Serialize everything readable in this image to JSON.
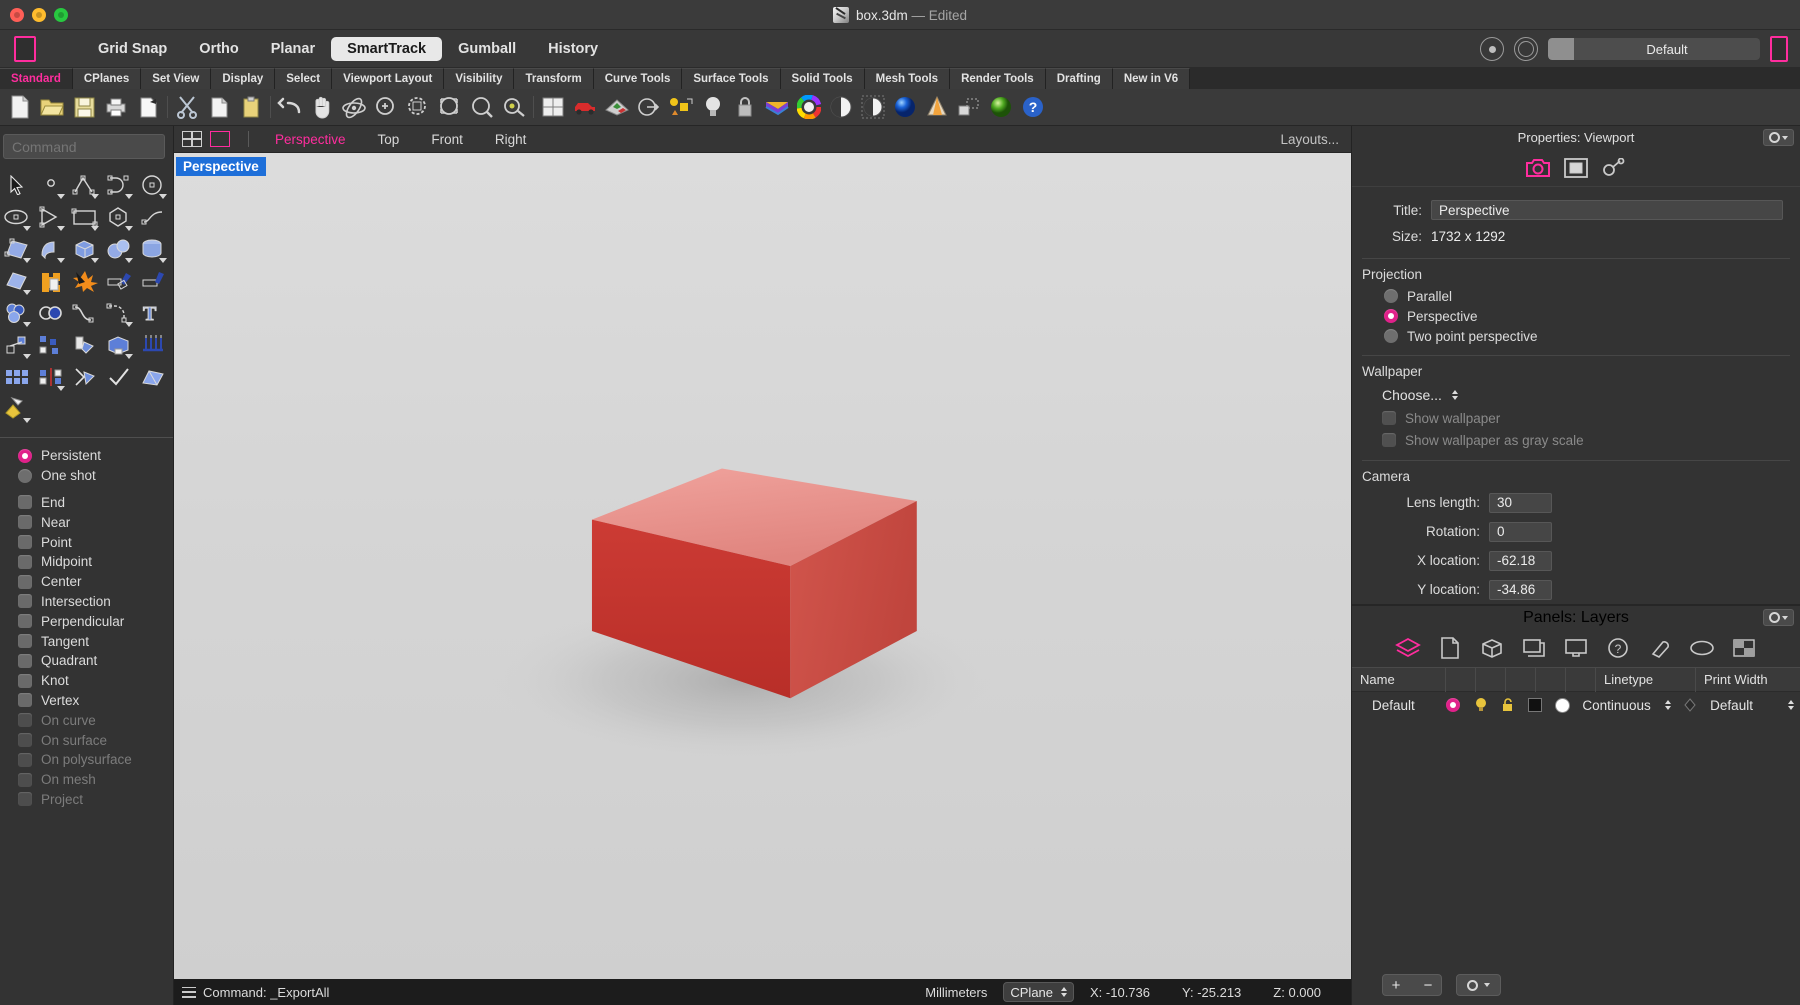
{
  "window": {
    "title": "box.3dm",
    "title_suffix": "— Edited",
    "traffic_lights": [
      "close",
      "minimize",
      "maximize"
    ]
  },
  "modebar": {
    "modes": [
      {
        "label": "Grid Snap",
        "active": false
      },
      {
        "label": "Ortho",
        "active": false
      },
      {
        "label": "Planar",
        "active": false
      },
      {
        "label": "SmartTrack",
        "active": true
      },
      {
        "label": "Gumball",
        "active": false
      },
      {
        "label": "History",
        "active": false
      }
    ],
    "display_mode": "Default"
  },
  "tabs": [
    {
      "label": "Standard",
      "active": true
    },
    {
      "label": "CPlanes",
      "active": false
    },
    {
      "label": "Set View",
      "active": false
    },
    {
      "label": "Display",
      "active": false
    },
    {
      "label": "Select",
      "active": false
    },
    {
      "label": "Viewport Layout",
      "active": false
    },
    {
      "label": "Visibility",
      "active": false
    },
    {
      "label": "Transform",
      "active": false
    },
    {
      "label": "Curve Tools",
      "active": false
    },
    {
      "label": "Surface Tools",
      "active": false
    },
    {
      "label": "Solid Tools",
      "active": false
    },
    {
      "label": "Mesh Tools",
      "active": false
    },
    {
      "label": "Render Tools",
      "active": false
    },
    {
      "label": "Drafting",
      "active": false
    },
    {
      "label": "New in V6",
      "active": false
    }
  ],
  "toolbar_icons": [
    "new-file-icon",
    "open-folder-icon",
    "save-icon",
    "print-icon",
    "copy-page-icon",
    "sep",
    "cut-scissors-icon",
    "copy-icon",
    "paste-clipboard-icon",
    "sep",
    "undo-icon",
    "pan-hand-icon",
    "rotate-view-icon",
    "zoom-window-icon",
    "zoom-extents-icon",
    "zoom-selected-icon",
    "zoom-dynamic-icon",
    "zoom-target-icon",
    "sep",
    "viewport-layout-icon",
    "car-render-icon",
    "render-preview-icon",
    "dimension-icon",
    "object-snap-icon",
    "light-bulb-icon",
    "lock-icon",
    "surface-icon",
    "color-wheel-icon",
    "shade-sphere-icon",
    "ghosted-sphere-icon",
    "rendered-sphere-icon",
    "cone-icon",
    "group-icon",
    "material-sphere-icon",
    "help-icon"
  ],
  "command_line": {
    "placeholder": "Command"
  },
  "tool_palette": {
    "rows": [
      [
        "select-arrow-icon",
        "point-icon",
        "polyline-icon",
        "curve-icon",
        "circle-icon"
      ],
      [
        "ellipse-icon",
        "arc-icon",
        "rectangle-icon",
        "polygon-icon",
        "freeform-curve-icon"
      ],
      [
        "surface-from-points-icon",
        "extrude-surface-icon",
        "box-icon",
        "sphere-boolean-icon",
        "cylinder-icon"
      ],
      [
        "patch-surface-icon",
        "boolean-union-icon",
        "explode-icon",
        "offset-surface-icon",
        "fillet-edge-icon"
      ],
      [
        "boolean-difference-icon",
        "boolean-intersection-icon",
        "blend-curve-icon",
        "fillet-curve-icon",
        "text-icon"
      ],
      [
        "move-icon",
        "array-icon",
        "rotate-icon",
        "scale-box-icon",
        "wall-icon"
      ],
      [
        "grid-array-icon",
        "mirror-icon",
        "trim-icon",
        "check-mark-icon",
        "split-icon"
      ],
      [
        "render-material-icon"
      ]
    ]
  },
  "osnap": {
    "modes": [
      {
        "label": "Persistent",
        "type": "radio",
        "checked": true,
        "enabled": true
      },
      {
        "label": "One shot",
        "type": "radio",
        "checked": false,
        "enabled": true
      }
    ],
    "items": [
      {
        "label": "End",
        "checked": false,
        "enabled": true
      },
      {
        "label": "Near",
        "checked": false,
        "enabled": true
      },
      {
        "label": "Point",
        "checked": false,
        "enabled": true
      },
      {
        "label": "Midpoint",
        "checked": false,
        "enabled": true
      },
      {
        "label": "Center",
        "checked": false,
        "enabled": true
      },
      {
        "label": "Intersection",
        "checked": false,
        "enabled": true
      },
      {
        "label": "Perpendicular",
        "checked": false,
        "enabled": true
      },
      {
        "label": "Tangent",
        "checked": false,
        "enabled": true
      },
      {
        "label": "Quadrant",
        "checked": false,
        "enabled": true
      },
      {
        "label": "Knot",
        "checked": false,
        "enabled": true
      },
      {
        "label": "Vertex",
        "checked": false,
        "enabled": true
      },
      {
        "label": "On curve",
        "checked": false,
        "enabled": false
      },
      {
        "label": "On surface",
        "checked": false,
        "enabled": false
      },
      {
        "label": "On polysurface",
        "checked": false,
        "enabled": false
      },
      {
        "label": "On mesh",
        "checked": false,
        "enabled": false
      },
      {
        "label": "Project",
        "checked": false,
        "enabled": false
      }
    ]
  },
  "viewport_bar": {
    "tabs": [
      {
        "label": "Perspective",
        "active": true
      },
      {
        "label": "Top",
        "active": false
      },
      {
        "label": "Front",
        "active": false
      },
      {
        "label": "Right",
        "active": false
      }
    ],
    "layouts_label": "Layouts..."
  },
  "viewport": {
    "label": "Perspective",
    "object": "red-box",
    "box_color_top": "#ef8e8a",
    "box_color_front": "#c4342f",
    "box_color_side": "#d8544c",
    "background_top": "#dcdcdc",
    "background_bottom": "#cfcfcf"
  },
  "properties_panel": {
    "header": "Properties: Viewport",
    "tool_icons": [
      "camera-icon",
      "viewport-frame-icon",
      "link-icon"
    ],
    "title_label": "Title:",
    "title_value": "Perspective",
    "size_label": "Size:",
    "size_value": "1732 x 1292",
    "projection_group": "Projection",
    "projection_options": [
      {
        "label": "Parallel",
        "checked": false
      },
      {
        "label": "Perspective",
        "checked": true
      },
      {
        "label": "Two point perspective",
        "checked": false
      }
    ],
    "wallpaper_group": "Wallpaper",
    "wallpaper_choose": "Choose...",
    "wallpaper_checks": [
      {
        "label": "Show wallpaper",
        "checked": false,
        "enabled": false
      },
      {
        "label": "Show wallpaper as gray scale",
        "checked": false,
        "enabled": false
      }
    ],
    "camera_group": "Camera",
    "camera_fields": [
      {
        "label": "Lens length:",
        "value": "30"
      },
      {
        "label": "Rotation:",
        "value": "0"
      },
      {
        "label": "X location:",
        "value": "-62.18"
      },
      {
        "label": "Y location:",
        "value": "-34.86"
      }
    ]
  },
  "layers_panel": {
    "header": "Panels: Layers",
    "tool_icons": [
      "layers-icon",
      "notes-icon",
      "object-properties-icon",
      "display-icon",
      "render-display-icon",
      "help-icon",
      "light-icon",
      "environment-icon",
      "ground-plane-icon"
    ],
    "columns": [
      "Name",
      "",
      "",
      "",
      "",
      "",
      "Linetype",
      "Print Width"
    ],
    "rows": [
      {
        "name": "Default",
        "color_on": "#e0218a",
        "light": "on",
        "lock": "unlocked",
        "swatch": "#111111",
        "material": "#ffffff",
        "linetype": "Continuous",
        "print_width": "Default"
      }
    ],
    "add_button": "+",
    "remove_button": "−"
  },
  "status_bar": {
    "command_label": "Command: _ExportAll",
    "units": "Millimeters",
    "cplane": "CPlane",
    "x": "X: -10.736",
    "y": "Y: -25.213",
    "z": "Z: 0.000"
  },
  "colors": {
    "accent_pink": "#ff2d9e",
    "accent_magenta": "#e0218a",
    "panel_bg": "#333333",
    "toolbar_bg": "#3a3a3a",
    "viewport_blue": "#1e6fd9"
  }
}
